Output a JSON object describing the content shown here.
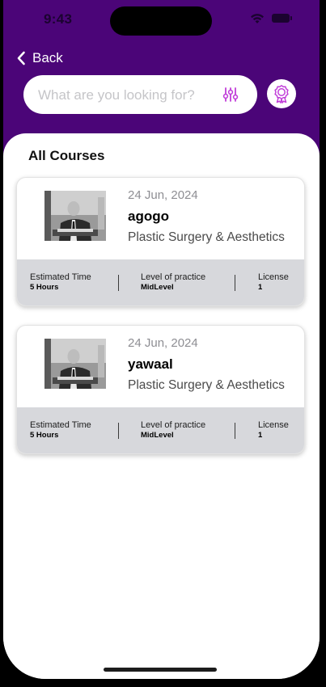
{
  "status_bar": {
    "time": "9:43"
  },
  "nav": {
    "back_label": "Back"
  },
  "search": {
    "placeholder": "What are you looking for?",
    "value": ""
  },
  "section": {
    "title": "All Courses"
  },
  "courses": [
    {
      "date": "24 Jun, 2024",
      "title": "agogo",
      "category": "Plastic Surgery & Aesthetics",
      "meta": {
        "time_label": "Estimated Time",
        "time_value": "5 Hours",
        "level_label": "Level of practice",
        "level_value": "MidLevel",
        "license_label": "License",
        "license_value": "1"
      }
    },
    {
      "date": "24 Jun, 2024",
      "title": "yawaal",
      "category": "Plastic Surgery & Aesthetics",
      "meta": {
        "time_label": "Estimated Time",
        "time_value": "5 Hours",
        "level_label": "Level of practice",
        "level_value": "MidLevel",
        "license_label": "License",
        "license_value": "1"
      }
    }
  ],
  "icons": {
    "back": "chevron-left-icon",
    "filter": "sliders-icon",
    "badge": "award-badge-icon",
    "wifi": "wifi-icon",
    "battery": "battery-icon"
  },
  "colors": {
    "header": "#4b0578",
    "accent": "#c13fd9",
    "meta_bg": "#d7d8dc"
  }
}
